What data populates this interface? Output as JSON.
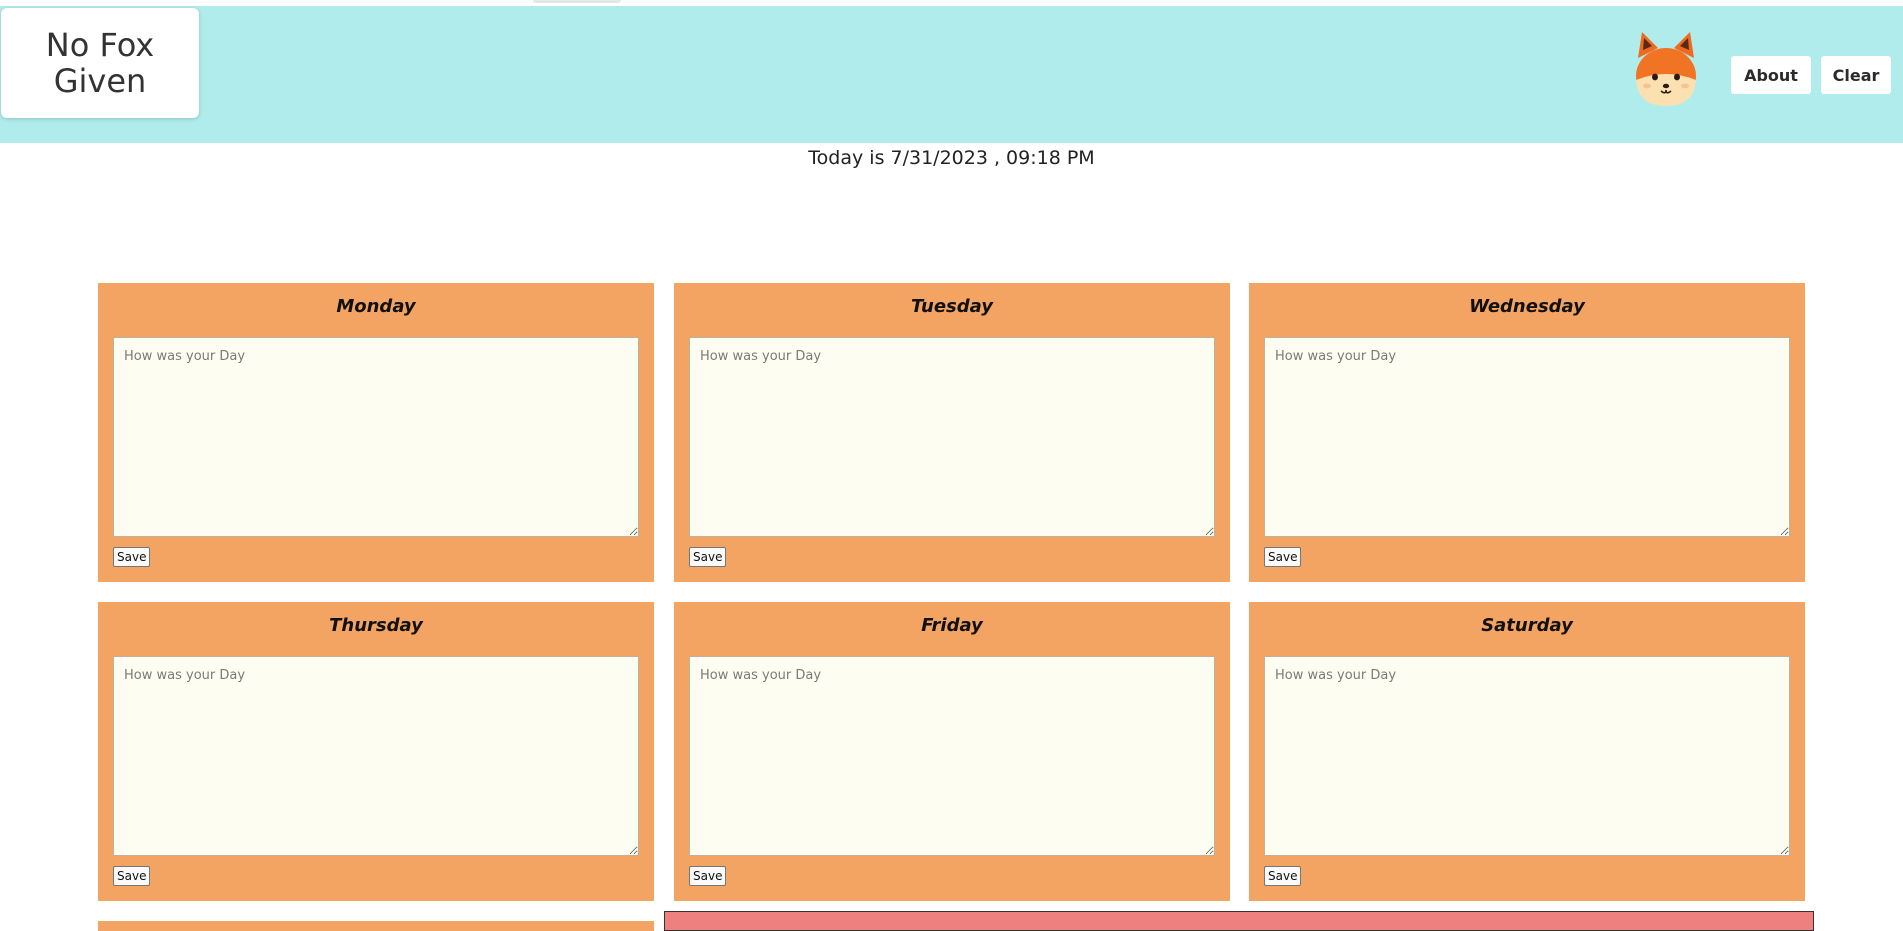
{
  "header": {
    "logo_text": "No Fox Given",
    "about_label": "About",
    "clear_label": "Clear",
    "background_color": "#b0ecec"
  },
  "today_text": "Today is 7/31/2023 , 09:18 PM",
  "days": [
    {
      "name": "Monday",
      "placeholder": "How was your Day",
      "value": "",
      "save_label": "Save"
    },
    {
      "name": "Tuesday",
      "placeholder": "How was your Day",
      "value": "",
      "save_label": "Save"
    },
    {
      "name": "Wednesday",
      "placeholder": "How was your Day",
      "value": "",
      "save_label": "Save"
    },
    {
      "name": "Thursday",
      "placeholder": "How was your Day",
      "value": "",
      "save_label": "Save"
    },
    {
      "name": "Friday",
      "placeholder": "How was your Day",
      "value": "",
      "save_label": "Save"
    },
    {
      "name": "Saturday",
      "placeholder": "How was your Day",
      "value": "",
      "save_label": "Save"
    }
  ],
  "colors": {
    "card": "#f3a462",
    "textarea": "#fdfef1",
    "bottom_panel": "#ef8080"
  },
  "icons": {
    "mascot": "fox-mascot-icon"
  }
}
